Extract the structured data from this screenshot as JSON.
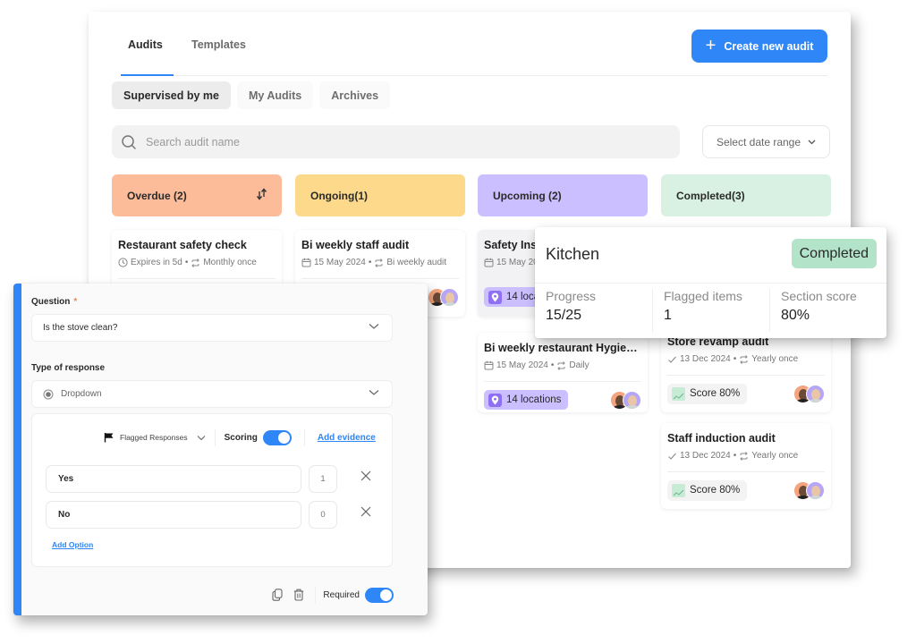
{
  "tabs": [
    {
      "label": "Audits",
      "active": true
    },
    {
      "label": "Templates",
      "active": false
    }
  ],
  "create_button": {
    "label": "Create new audit",
    "icon": "plus-icon"
  },
  "filters": [
    {
      "label": "Supervised by me",
      "active": true
    },
    {
      "label": "My Audits",
      "active": false
    },
    {
      "label": "Archives",
      "active": false
    }
  ],
  "search": {
    "placeholder": "Search audit name",
    "value": ""
  },
  "date_range": {
    "label": "Select date range"
  },
  "colors": {
    "accent": "#2e86f7",
    "overdue": "#fcbb99",
    "ongoing": "#fdd98c",
    "upcoming": "#cbbfff",
    "completed": "#d8f1e2",
    "completed_badge": "#b3e3c8",
    "required_star": "#e8865a"
  },
  "columns": [
    {
      "label": "Overdue (2)",
      "has_sort": true,
      "cards": [
        {
          "title": "Restaurant safety check",
          "meta_icon": "clock-icon",
          "date": "Expires in 5d",
          "recurrence": "Monthly once"
        }
      ]
    },
    {
      "label": "Ongoing(1)",
      "cards": [
        {
          "title": "Bi weekly staff audit",
          "meta_icon": "calendar-icon",
          "date": "15 May 2024",
          "recurrence": "Bi weekly audit"
        }
      ]
    },
    {
      "label": "Upcoming (2)",
      "cards": [
        {
          "title": "Safety Insp",
          "meta_icon": "calendar-icon",
          "date": "15 May 20",
          "recurrence": "",
          "badge": "14 loca"
        },
        {
          "title": "Bi weekly restaurant Hygiene l...",
          "meta_icon": "calendar-icon",
          "date": "15 May 2024",
          "recurrence": "Daily",
          "badge": "14 locations"
        }
      ]
    },
    {
      "label": "Completed(3)",
      "cards": [
        {
          "title": "Store revamp audit",
          "meta_icon": "check-icon",
          "date": "13 Dec 2024",
          "recurrence": "Yearly once",
          "badge": "Score 80%"
        },
        {
          "title": "Staff induction audit",
          "meta_icon": "check-icon",
          "date": "13 Dec 2024",
          "recurrence": "Yearly once",
          "badge": "Score 80%"
        }
      ]
    }
  ],
  "kitchen": {
    "title": "Kitchen",
    "status": "Completed",
    "stats": [
      {
        "label": "Progress",
        "value": "15/25"
      },
      {
        "label": "Flagged items",
        "value": "1"
      },
      {
        "label": "Section score",
        "value": "80%"
      }
    ]
  },
  "question_editor": {
    "question_label": "Question",
    "required_marker": "*",
    "question_value": "Is the stove clean?",
    "response_type_label": "Type of response",
    "response_type_value": "Dropdown",
    "flagged_label": "Flagged Responses",
    "scoring_label": "Scoring",
    "scoring_on": true,
    "add_evidence_label": "Add evidence",
    "options": [
      {
        "label": "Yes",
        "score": "1"
      },
      {
        "label": "No",
        "score": "0"
      }
    ],
    "add_option_label": "Add Option",
    "required_label": "Required",
    "required_on": true
  }
}
